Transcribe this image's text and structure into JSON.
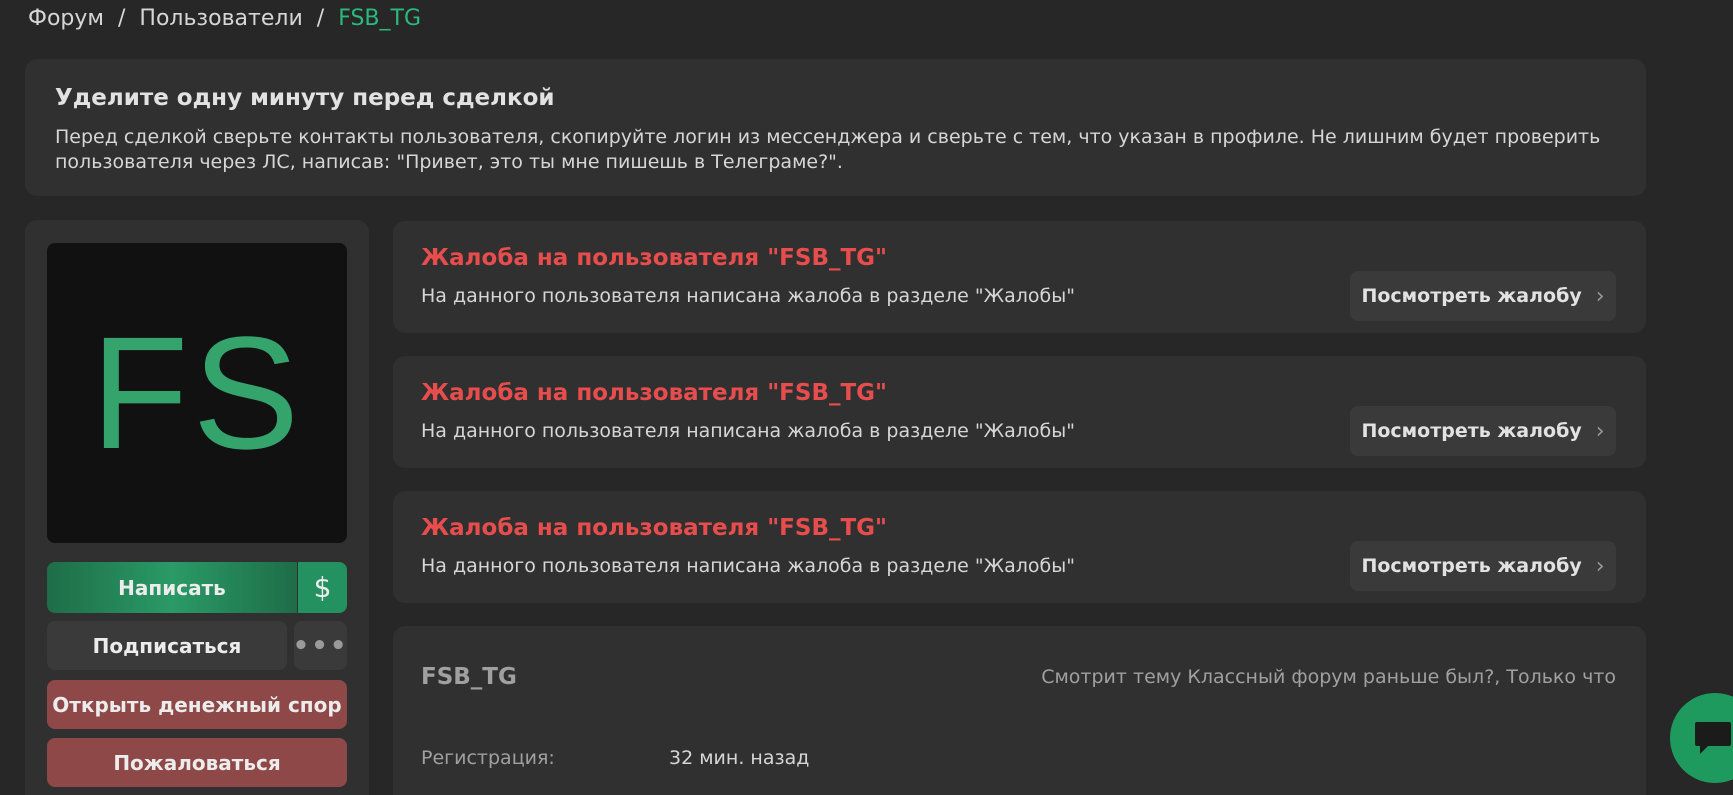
{
  "breadcrumb": {
    "items": [
      "Форум",
      "Пользователи"
    ],
    "separator": "/",
    "current": "FSB_TG"
  },
  "notice": {
    "title": "Уделите одну минуту перед сделкой",
    "text_line1": "Перед сделкой сверьте контакты пользователя, скопируйте логин из мессенджера и сверьте с тем, что указан в профиле. Не лишним будет проверить",
    "text_line2": "пользователя через ЛС, написав: \"Привет, это ты мне пишешь в Телеграме?\"."
  },
  "avatar": {
    "initials": "FS",
    "color": "#34a46c"
  },
  "actions": {
    "write": "Написать",
    "dollar": "$",
    "subscribe": "Подписаться",
    "more": "•••",
    "dispute": "Открыть денежный спор",
    "report": "Пожаловаться"
  },
  "complaints": [
    {
      "title": "Жалоба на пользователя \"FSB_TG\"",
      "desc": "На данного пользователя написана жалоба в разделе \"Жалобы\"",
      "button": "Посмотреть жалобу"
    },
    {
      "title": "Жалоба на пользователя \"FSB_TG\"",
      "desc": "На данного пользователя написана жалоба в разделе \"Жалобы\"",
      "button": "Посмотреть жалобу"
    },
    {
      "title": "Жалоба на пользователя \"FSB_TG\"",
      "desc": "На данного пользователя написана жалоба в разделе \"Жалобы\"",
      "button": "Посмотреть жалобу"
    }
  ],
  "profile": {
    "username": "FSB_TG",
    "activity": "Смотрит тему Классный форум раньше был?, Только что",
    "registration_label": "Регистрация:",
    "registration_value": "32 мин. назад"
  },
  "colors": {
    "accent": "#2bb97f",
    "danger": "#e84d4d",
    "danger_button": "#8e4848",
    "background": "#272727",
    "panel": "#303030"
  }
}
